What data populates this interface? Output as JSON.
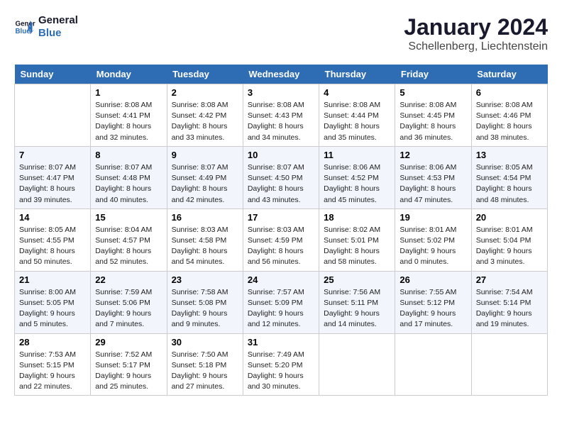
{
  "header": {
    "logo_line1": "General",
    "logo_line2": "Blue",
    "month_year": "January 2024",
    "location": "Schellenberg, Liechtenstein"
  },
  "weekdays": [
    "Sunday",
    "Monday",
    "Tuesday",
    "Wednesday",
    "Thursday",
    "Friday",
    "Saturday"
  ],
  "weeks": [
    [
      {
        "day": "",
        "empty": true
      },
      {
        "day": "1",
        "sunrise": "8:08 AM",
        "sunset": "4:41 PM",
        "daylight": "8 hours and 32 minutes."
      },
      {
        "day": "2",
        "sunrise": "8:08 AM",
        "sunset": "4:42 PM",
        "daylight": "8 hours and 33 minutes."
      },
      {
        "day": "3",
        "sunrise": "8:08 AM",
        "sunset": "4:43 PM",
        "daylight": "8 hours and 34 minutes."
      },
      {
        "day": "4",
        "sunrise": "8:08 AM",
        "sunset": "4:44 PM",
        "daylight": "8 hours and 35 minutes."
      },
      {
        "day": "5",
        "sunrise": "8:08 AM",
        "sunset": "4:45 PM",
        "daylight": "8 hours and 36 minutes."
      },
      {
        "day": "6",
        "sunrise": "8:08 AM",
        "sunset": "4:46 PM",
        "daylight": "8 hours and 38 minutes."
      }
    ],
    [
      {
        "day": "7",
        "sunrise": "8:07 AM",
        "sunset": "4:47 PM",
        "daylight": "8 hours and 39 minutes."
      },
      {
        "day": "8",
        "sunrise": "8:07 AM",
        "sunset": "4:48 PM",
        "daylight": "8 hours and 40 minutes."
      },
      {
        "day": "9",
        "sunrise": "8:07 AM",
        "sunset": "4:49 PM",
        "daylight": "8 hours and 42 minutes."
      },
      {
        "day": "10",
        "sunrise": "8:07 AM",
        "sunset": "4:50 PM",
        "daylight": "8 hours and 43 minutes."
      },
      {
        "day": "11",
        "sunrise": "8:06 AM",
        "sunset": "4:52 PM",
        "daylight": "8 hours and 45 minutes."
      },
      {
        "day": "12",
        "sunrise": "8:06 AM",
        "sunset": "4:53 PM",
        "daylight": "8 hours and 47 minutes."
      },
      {
        "day": "13",
        "sunrise": "8:05 AM",
        "sunset": "4:54 PM",
        "daylight": "8 hours and 48 minutes."
      }
    ],
    [
      {
        "day": "14",
        "sunrise": "8:05 AM",
        "sunset": "4:55 PM",
        "daylight": "8 hours and 50 minutes."
      },
      {
        "day": "15",
        "sunrise": "8:04 AM",
        "sunset": "4:57 PM",
        "daylight": "8 hours and 52 minutes."
      },
      {
        "day": "16",
        "sunrise": "8:03 AM",
        "sunset": "4:58 PM",
        "daylight": "8 hours and 54 minutes."
      },
      {
        "day": "17",
        "sunrise": "8:03 AM",
        "sunset": "4:59 PM",
        "daylight": "8 hours and 56 minutes."
      },
      {
        "day": "18",
        "sunrise": "8:02 AM",
        "sunset": "5:01 PM",
        "daylight": "8 hours and 58 minutes."
      },
      {
        "day": "19",
        "sunrise": "8:01 AM",
        "sunset": "5:02 PM",
        "daylight": "9 hours and 0 minutes."
      },
      {
        "day": "20",
        "sunrise": "8:01 AM",
        "sunset": "5:04 PM",
        "daylight": "9 hours and 3 minutes."
      }
    ],
    [
      {
        "day": "21",
        "sunrise": "8:00 AM",
        "sunset": "5:05 PM",
        "daylight": "9 hours and 5 minutes."
      },
      {
        "day": "22",
        "sunrise": "7:59 AM",
        "sunset": "5:06 PM",
        "daylight": "9 hours and 7 minutes."
      },
      {
        "day": "23",
        "sunrise": "7:58 AM",
        "sunset": "5:08 PM",
        "daylight": "9 hours and 9 minutes."
      },
      {
        "day": "24",
        "sunrise": "7:57 AM",
        "sunset": "5:09 PM",
        "daylight": "9 hours and 12 minutes."
      },
      {
        "day": "25",
        "sunrise": "7:56 AM",
        "sunset": "5:11 PM",
        "daylight": "9 hours and 14 minutes."
      },
      {
        "day": "26",
        "sunrise": "7:55 AM",
        "sunset": "5:12 PM",
        "daylight": "9 hours and 17 minutes."
      },
      {
        "day": "27",
        "sunrise": "7:54 AM",
        "sunset": "5:14 PM",
        "daylight": "9 hours and 19 minutes."
      }
    ],
    [
      {
        "day": "28",
        "sunrise": "7:53 AM",
        "sunset": "5:15 PM",
        "daylight": "9 hours and 22 minutes."
      },
      {
        "day": "29",
        "sunrise": "7:52 AM",
        "sunset": "5:17 PM",
        "daylight": "9 hours and 25 minutes."
      },
      {
        "day": "30",
        "sunrise": "7:50 AM",
        "sunset": "5:18 PM",
        "daylight": "9 hours and 27 minutes."
      },
      {
        "day": "31",
        "sunrise": "7:49 AM",
        "sunset": "5:20 PM",
        "daylight": "9 hours and 30 minutes."
      },
      {
        "day": "",
        "empty": true
      },
      {
        "day": "",
        "empty": true
      },
      {
        "day": "",
        "empty": true
      }
    ]
  ],
  "labels": {
    "sunrise_prefix": "Sunrise: ",
    "sunset_prefix": "Sunset: ",
    "daylight_prefix": "Daylight: "
  }
}
